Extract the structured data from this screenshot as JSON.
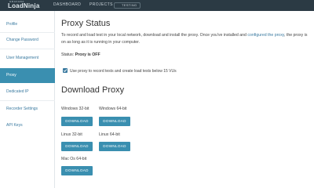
{
  "topbar": {
    "brand_small": "GRAFANA",
    "brand": "LoadNinja",
    "nav_dashboard": "DASHBOARD",
    "nav_projects": "PROJECTS",
    "nav_testing": "TESTING"
  },
  "sidebar": {
    "items": [
      {
        "label": "Profile"
      },
      {
        "label": "Change Password"
      },
      {
        "label": "User Management"
      },
      {
        "label": "Proxy"
      },
      {
        "label": "Dedicated IP"
      },
      {
        "label": "Recorder Settings"
      },
      {
        "label": "API Keys"
      }
    ],
    "active_index": 3
  },
  "proxy_status": {
    "title": "Proxy Status",
    "description_part1": "To record and load test in your local network, download and install the proxy. Once you've installed and",
    "description_link": "configured the proxy",
    "description_part2": ", the proxy is on as long as it is running in your computer.",
    "status_label": "Status:",
    "status_value": "Proxy is OFF",
    "checkbox_label": "Use proxy to record tests and create load tests below 15 VUs",
    "checkbox_checked": true
  },
  "download_proxy": {
    "title": "Download Proxy",
    "downloads": [
      {
        "os": "Windows 32-bit",
        "button": "DOWNLOAD"
      },
      {
        "os": "Windows 64-bit",
        "button": "DOWNLOAD"
      },
      {
        "os": "Linux 32-bit",
        "button": "DOWNLOAD"
      },
      {
        "os": "Linux 64-bit",
        "button": "DOWNLOAD"
      },
      {
        "os": "Mac Os 64-bit",
        "button": "DOWNLOAD"
      }
    ]
  },
  "colors": {
    "topbar": "#2b3a44",
    "accent": "#3a8fb0",
    "link": "#3a7aa0"
  }
}
